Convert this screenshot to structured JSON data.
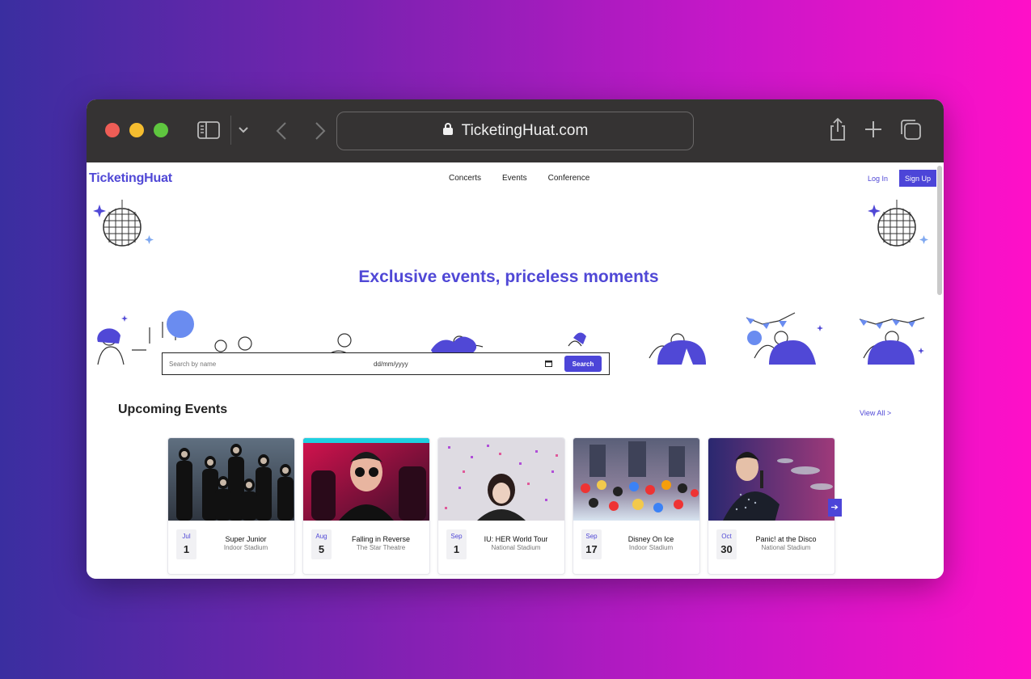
{
  "browser": {
    "url": "TicketingHuat.com"
  },
  "site": {
    "brand": "TicketingHuat",
    "nav": [
      "Concerts",
      "Events",
      "Conference"
    ],
    "login": "Log In",
    "signup": "Sign Up"
  },
  "hero": {
    "headline": "Exclusive events, priceless moments"
  },
  "search": {
    "placeholder": "Search by name",
    "date_placeholder": "dd/mm/yyyy",
    "button": "Search"
  },
  "upcoming": {
    "title": "Upcoming Events",
    "view_all": "View All >",
    "events": [
      {
        "month": "Jul",
        "day": "1",
        "title": "Super Junior",
        "venue": "Indoor Stadium"
      },
      {
        "month": "Aug",
        "day": "5",
        "title": "Falling in Reverse",
        "venue": "The Star Theatre"
      },
      {
        "month": "Sep",
        "day": "1",
        "title": "IU: HER World Tour",
        "venue": "National Stadium"
      },
      {
        "month": "Sep",
        "day": "17",
        "title": "Disney On Ice",
        "venue": "Indoor Stadium"
      },
      {
        "month": "Oct",
        "day": "30",
        "title": "Panic! at the Disco",
        "venue": "National Stadium"
      }
    ],
    "next_icon": "arrow-right-icon"
  },
  "colors": {
    "accent": "#5048d6",
    "titlebar": "#353333"
  }
}
